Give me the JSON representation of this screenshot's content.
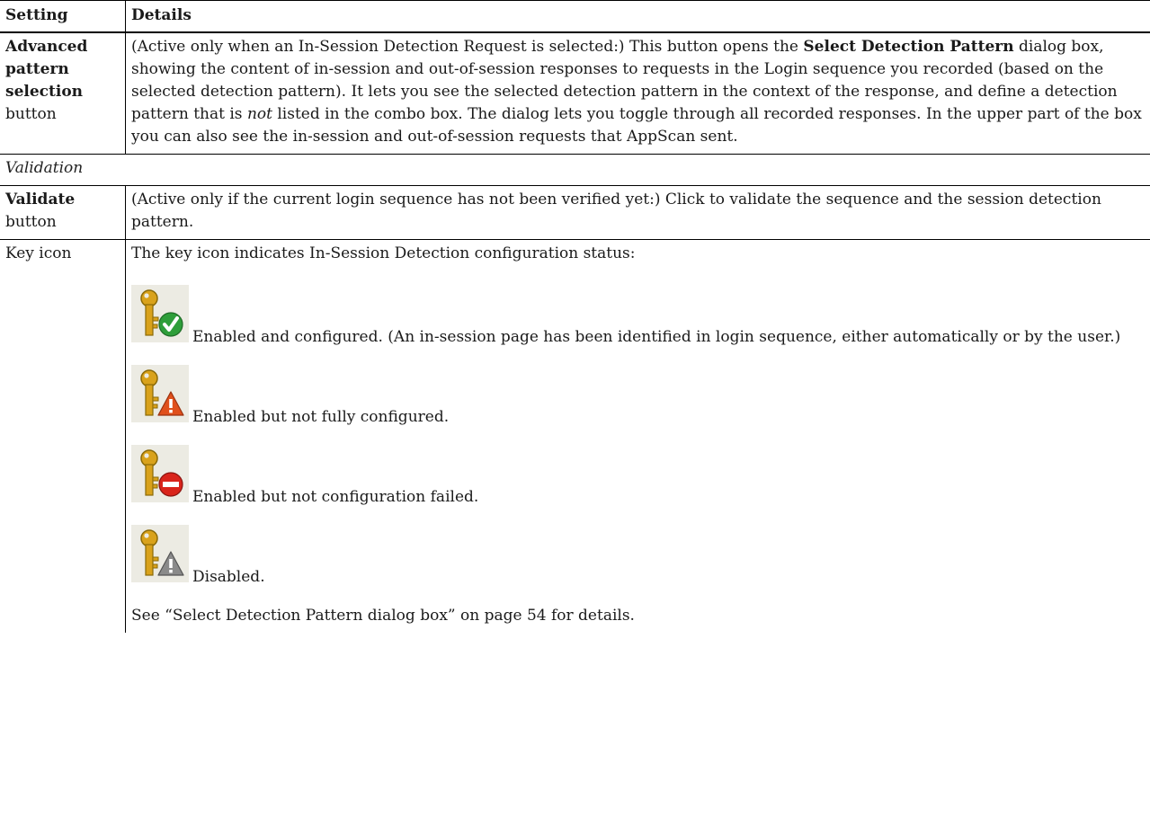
{
  "table": {
    "header": {
      "setting": "Setting",
      "details": "Details"
    },
    "advanced": {
      "setting": [
        "Advanced",
        "pattern",
        "selection"
      ],
      "setting_suffix": "button",
      "details": {
        "intro": "(Active only when an In-Session Detection Request is selected:) This button opens the ",
        "bold_name": "Select Detection Pattern",
        "mid": " dialog box, showing the content of in-session and out-of-session responses to requests in the Login sequence you recorded (based on the selected detection pattern). It lets you see the selected detection pattern in the context of the response, and define a detection pattern that is ",
        "italic_word": "not",
        "end": " listed in the combo box. The dialog lets you toggle through all recorded responses. In the upper part of the box you can also see the in-session and out-of-session requests that AppScan sent."
      }
    },
    "section_validation": "Validation",
    "validate": {
      "setting_bold": "Validate",
      "setting_suffix": "button",
      "details": "(Active only if the current login sequence has not been verified yet:) Click to validate the sequence and the session detection pattern."
    },
    "key": {
      "setting": "Key icon",
      "intro": "The key icon indicates In-Session Detection configuration status:",
      "statuses": [
        {
          "icon": "key-check-icon",
          "text": "Enabled and configured. (An in-session page has been identified in login sequence, either automatically or by the user.)",
          "badge_color": "#2e9e3a"
        },
        {
          "icon": "key-warning-icon",
          "text": "Enabled but not fully configured.",
          "badge_color": "#e0501c"
        },
        {
          "icon": "key-error-icon",
          "text": "Enabled but not configuration failed.",
          "badge_color": "#d9241b"
        },
        {
          "icon": "key-disabled-icon",
          "text": "Disabled.",
          "badge_color": "#8a8a8a"
        }
      ],
      "see_also": "See “Select Detection Pattern dialog box” on page 54 for details."
    }
  },
  "colors": {
    "key_gold": "#d9a21b",
    "icon_bg": "#ecebe3"
  }
}
